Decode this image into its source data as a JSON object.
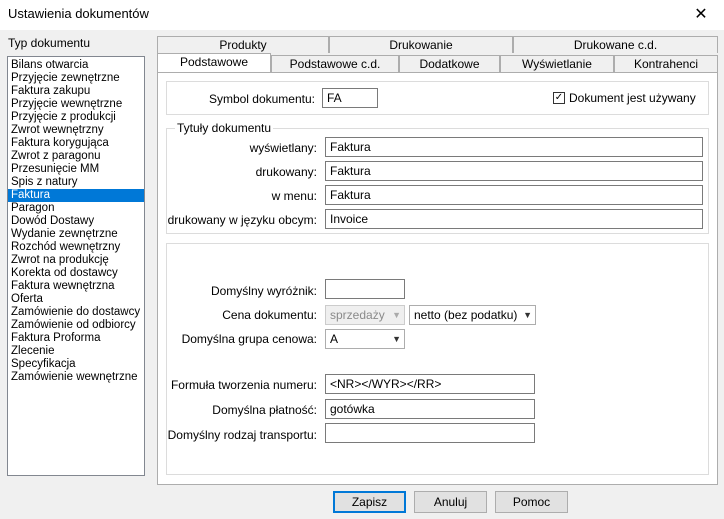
{
  "window": {
    "title": "Ustawienia dokumentów",
    "close_glyph": "✕"
  },
  "sidebar": {
    "label": "Typ dokumentu",
    "items": [
      "Bilans otwarcia",
      "Przyjęcie zewnętrzne",
      "Faktura zakupu",
      "Przyjęcie wewnętrzne",
      "Przyjęcie z produkcji",
      "Zwrot wewnętrzny",
      "Faktura korygująca",
      "Zwrot z paragonu",
      "Przesunięcie MM",
      "Spis z natury",
      "Faktura",
      "Paragon",
      "Dowód Dostawy",
      "Wydanie zewnętrzne",
      "Rozchód wewnętrzny",
      "Zwrot na produkcję",
      "Korekta od dostawcy",
      "Faktura wewnętrzna",
      "Oferta",
      "Zamówienie do dostawcy",
      "Zamówienie od odbiorcy",
      "Faktura Proforma",
      "Zlecenie",
      "Specyfikacja",
      "Zamówienie wewnętrzne"
    ],
    "selected": "Faktura"
  },
  "tabs": {
    "row1": [
      "Produkty",
      "Drukowanie",
      "Drukowane c.d."
    ],
    "row2": [
      "Podstawowe",
      "Podstawowe c.d.",
      "Dodatkowe",
      "Wyświetlanie",
      "Kontrahenci"
    ],
    "active": "Podstawowe"
  },
  "symbol": {
    "label": "Symbol dokumentu:",
    "value": "FA"
  },
  "used_checkbox": {
    "label": "Dokument jest używany",
    "checked": true,
    "mark": "✓"
  },
  "titles": {
    "group_label": "Tytuły dokumentu",
    "displayed": {
      "label": "wyświetlany:",
      "value": "Faktura"
    },
    "printed": {
      "label": "drukowany:",
      "value": "Faktura"
    },
    "menu": {
      "label": "w menu:",
      "value": "Faktura"
    },
    "foreign": {
      "label": "drukowany w języku obcym:",
      "value": "Invoice"
    }
  },
  "settings": {
    "marker": {
      "label": "Domyślny wyróżnik:",
      "value": ""
    },
    "price": {
      "label": "Cena dokumentu:",
      "type_value": "sprzedaży",
      "tax_value": "netto (bez podatku)"
    },
    "price_group": {
      "label": "Domyślna grupa cenowa:",
      "value": "A"
    },
    "formula": {
      "label": "Formuła tworzenia numeru:",
      "value": "<NR></WYR></RR>"
    },
    "payment": {
      "label": "Domyślna płatność:",
      "value": "gotówka"
    },
    "transport": {
      "label": "Domyślny rodzaj transportu:",
      "value": ""
    }
  },
  "buttons": {
    "save": "Zapisz",
    "cancel": "Anuluj",
    "help": "Pomoc"
  },
  "icons": {
    "dropdown": "chevron-down-icon",
    "close": "close-icon",
    "dropdown_glyph": "▼"
  },
  "colors": {
    "selection": "#0078d7",
    "default_button_border": "#0078d7"
  }
}
